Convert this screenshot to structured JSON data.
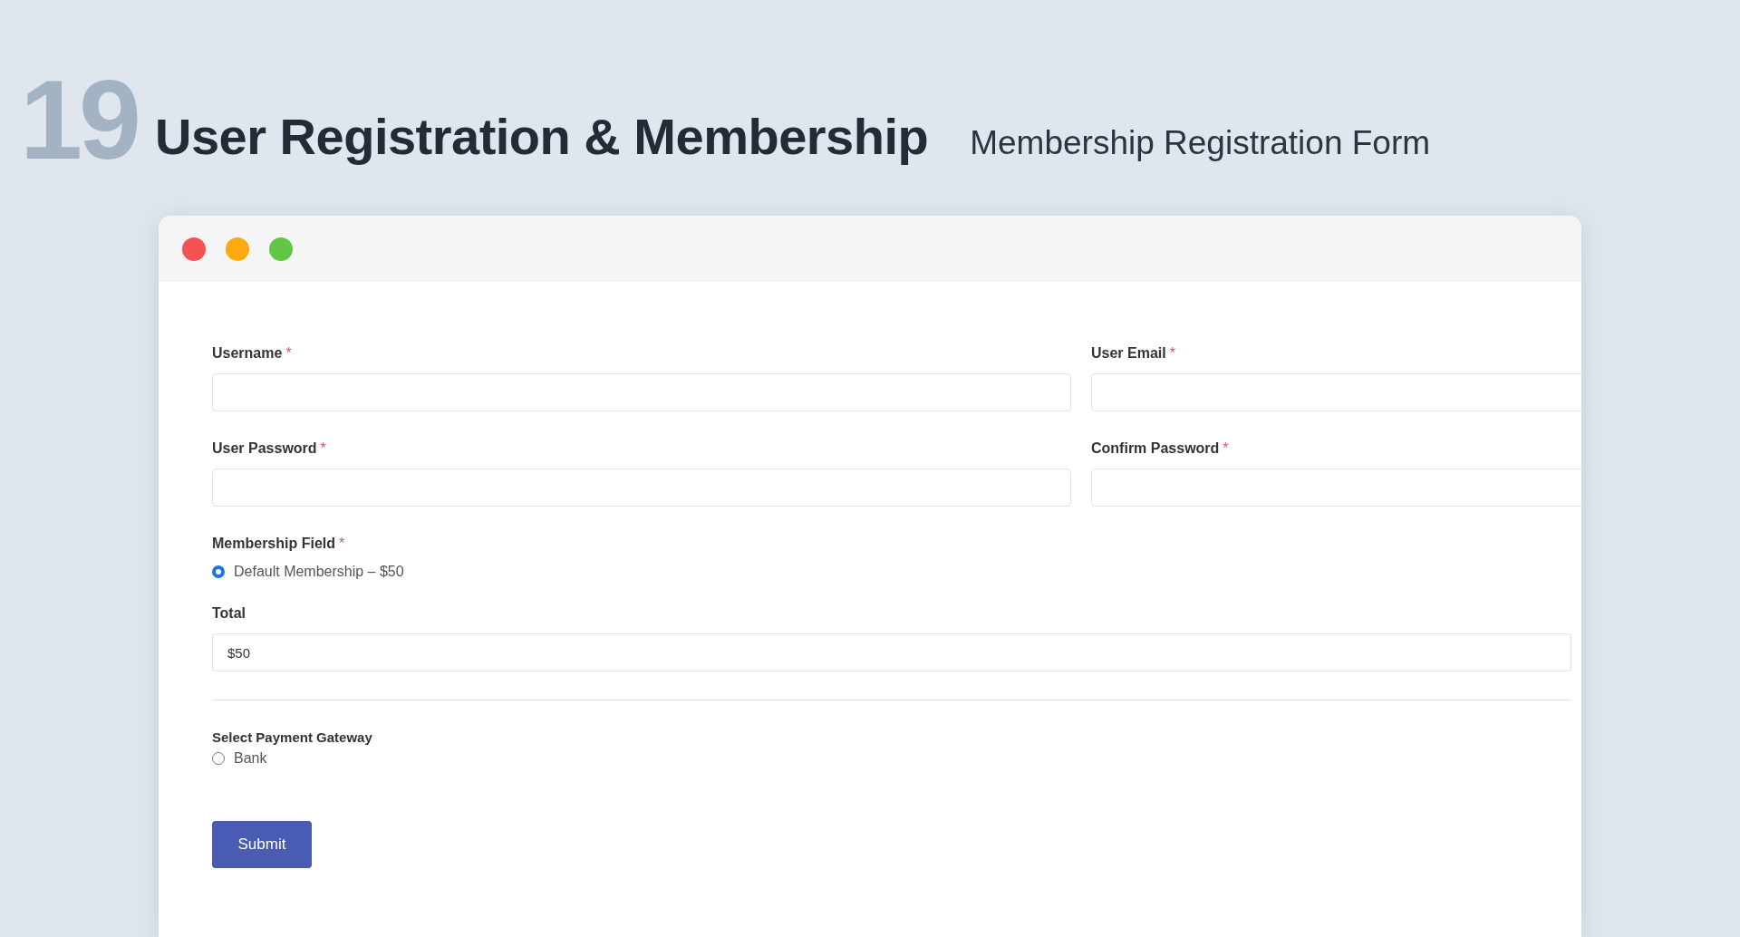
{
  "slide": {
    "number": "19",
    "title": "User Registration & Membership",
    "subtitle": "Membership Registration Form"
  },
  "window": {
    "controls": [
      {
        "color": "#f55353"
      },
      {
        "color": "#fcaa10"
      },
      {
        "color": "#62c544"
      }
    ]
  },
  "form": {
    "field_rows": [
      [
        {
          "label": "Username",
          "required_mark": "*"
        },
        {
          "label": "User Email",
          "required_mark": "*"
        }
      ],
      [
        {
          "label": "User Password",
          "required_mark": "*"
        },
        {
          "label": "Confirm Password",
          "required_mark": "*"
        }
      ]
    ],
    "membership": {
      "label": "Membership Field",
      "required_mark": "*",
      "options": [
        {
          "label": "Default Membership – $50",
          "selected": true
        }
      ]
    },
    "total": {
      "label": "Total",
      "value": "$50"
    },
    "payment": {
      "label": "Select Payment Gateway",
      "options": [
        {
          "label": "Bank",
          "selected": false
        }
      ]
    },
    "submit": "Submit"
  }
}
